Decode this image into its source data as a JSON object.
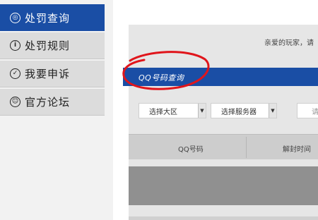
{
  "sidebar": {
    "items": [
      {
        "label": "处罚查询",
        "icon": "◎",
        "active": true
      },
      {
        "label": "处罚规则",
        "icon": "i",
        "active": false
      },
      {
        "label": "我要申诉",
        "icon": "✓",
        "active": false
      },
      {
        "label": "官方论坛",
        "icon": "☺",
        "active": false
      }
    ]
  },
  "main": {
    "notice_text": "亲爱的玩家，请",
    "section_title": "QQ号码查询",
    "filters": {
      "region_select": "选择大区",
      "server_select": "选择服务器",
      "qq_input_placeholder": "请输入"
    },
    "table": {
      "columns": [
        "QQ号码",
        "解封时间"
      ]
    }
  },
  "colors": {
    "accent": "#1a4ea5",
    "annotation": "#e0151b"
  }
}
